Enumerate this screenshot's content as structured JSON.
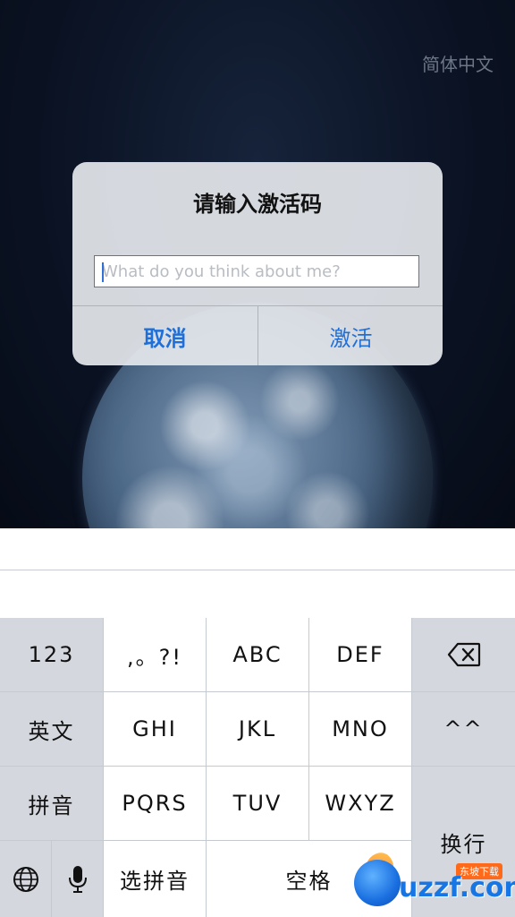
{
  "header": {
    "language_label": "简体中文"
  },
  "dialog": {
    "title": "请输入激活码",
    "input_placeholder": "What do you think about me?",
    "cancel_label": "取消",
    "activate_label": "激活"
  },
  "keyboard": {
    "row1": [
      "123",
      ",。?!",
      "ABC",
      "DEF"
    ],
    "row2": [
      "英文",
      "GHI",
      "JKL",
      "MNO",
      "^^"
    ],
    "row3": [
      "拼音",
      "PQRS",
      "TUV",
      "WXYZ"
    ],
    "enter_label": "换行",
    "select_pinyin_label": "选拼音",
    "space_label": "空格",
    "backspace_icon": "backspace-icon",
    "globe_icon": "globe-icon",
    "mic_icon": "microphone-icon"
  },
  "watermark": {
    "text": "uzzf.com",
    "badge": "东坡下载"
  },
  "colors": {
    "accent": "#1e6fd9",
    "key_white": "#ffffff",
    "key_gray": "#d4d8de"
  }
}
